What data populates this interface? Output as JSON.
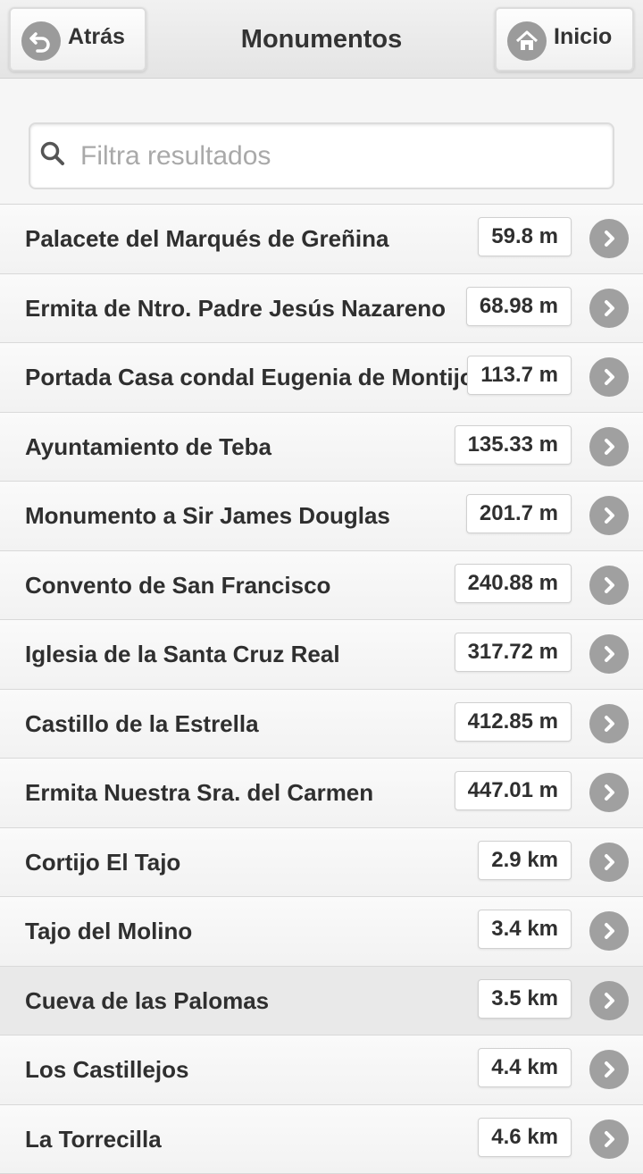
{
  "header": {
    "title": "Monumentos",
    "back_label": "Atrás",
    "home_label": "Inicio"
  },
  "search": {
    "placeholder": "Filtra resultados",
    "value": ""
  },
  "items": [
    {
      "name": "Palacete del Marqués de Greñina",
      "distance": "59.8 m"
    },
    {
      "name": "Ermita de Ntro. Padre Jesús Nazareno",
      "distance": "68.98 m"
    },
    {
      "name": "Portada Casa condal Eugenia de Montijo",
      "distance": "113.7 m"
    },
    {
      "name": "Ayuntamiento de Teba",
      "distance": "135.33 m"
    },
    {
      "name": "Monumento a Sir James Douglas",
      "distance": "201.7 m"
    },
    {
      "name": "Convento de San Francisco",
      "distance": "240.88 m"
    },
    {
      "name": "Iglesia de la Santa Cruz Real",
      "distance": "317.72 m"
    },
    {
      "name": "Castillo de la Estrella",
      "distance": "412.85 m"
    },
    {
      "name": "Ermita Nuestra Sra. del Carmen",
      "distance": "447.01 m"
    },
    {
      "name": "Cortijo El Tajo",
      "distance": "2.9 km"
    },
    {
      "name": "Tajo del Molino",
      "distance": "3.4 km"
    },
    {
      "name": "Cueva de las Palomas",
      "distance": "3.5 km"
    },
    {
      "name": "Los Castillejos",
      "distance": "4.4 km"
    },
    {
      "name": "La Torrecilla",
      "distance": "4.6 km"
    }
  ],
  "icons": {
    "back": "back-arrow-icon",
    "home": "home-icon",
    "search": "search-icon",
    "row": "chevron-right-icon"
  },
  "colors": {
    "icon_circle": "#9b9b9b",
    "text": "#2f2f2f"
  }
}
